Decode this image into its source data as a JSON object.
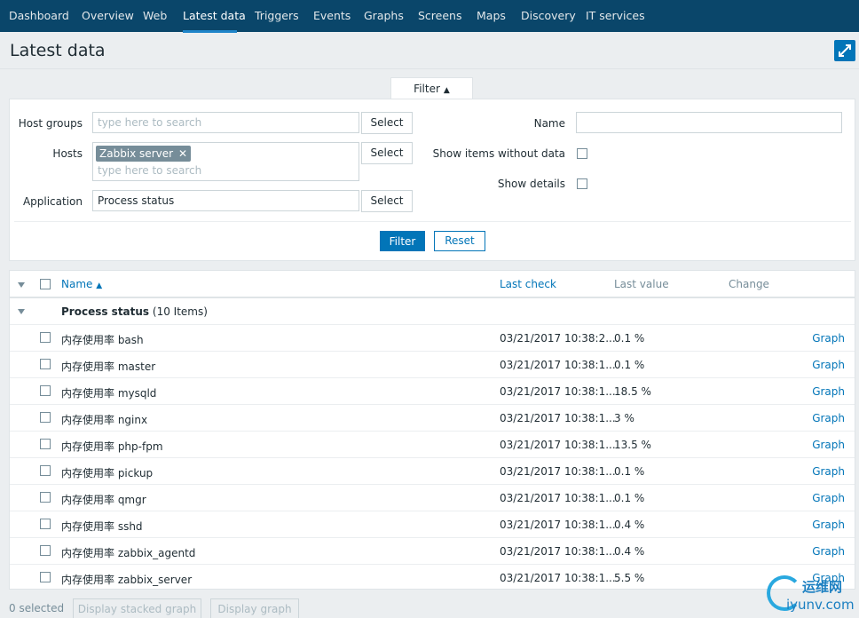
{
  "nav": {
    "items": [
      "Dashboard",
      "Overview",
      "Web",
      "Latest data",
      "Triggers",
      "Events",
      "Graphs",
      "Screens",
      "Maps",
      "Discovery",
      "IT services"
    ]
  },
  "page": {
    "title": "Latest data"
  },
  "filter": {
    "tab_label": "Filter",
    "host_groups_label": "Host groups",
    "host_groups_placeholder": "type here to search",
    "hosts_label": "Hosts",
    "hosts_chip": "Zabbix server",
    "hosts_placeholder": "type here to search",
    "application_label": "Application",
    "application_value": "Process status",
    "select_label": "Select",
    "name_label": "Name",
    "show_without_data_label": "Show items without data",
    "show_details_label": "Show details",
    "filter_button": "Filter",
    "reset_button": "Reset"
  },
  "table": {
    "headers": {
      "name": "Name",
      "last_check": "Last check",
      "last_value": "Last value",
      "change": "Change"
    },
    "group_name": "Process status",
    "group_count": "(10 Items)",
    "rows": [
      {
        "name": "内存使用率 bash",
        "last_check": "03/21/2017 10:38:2...",
        "last_value": "0.1 %",
        "action": "Graph"
      },
      {
        "name": "内存使用率 master",
        "last_check": "03/21/2017 10:38:1...",
        "last_value": "0.1 %",
        "action": "Graph"
      },
      {
        "name": "内存使用率 mysqld",
        "last_check": "03/21/2017 10:38:1...",
        "last_value": "18.5 %",
        "action": "Graph"
      },
      {
        "name": "内存使用率 nginx",
        "last_check": "03/21/2017 10:38:1...",
        "last_value": "3 %",
        "action": "Graph"
      },
      {
        "name": "内存使用率 php-fpm",
        "last_check": "03/21/2017 10:38:1...",
        "last_value": "13.5 %",
        "action": "Graph"
      },
      {
        "name": "内存使用率 pickup",
        "last_check": "03/21/2017 10:38:1...",
        "last_value": "0.1 %",
        "action": "Graph"
      },
      {
        "name": "内存使用率 qmgr",
        "last_check": "03/21/2017 10:38:1...",
        "last_value": "0.1 %",
        "action": "Graph"
      },
      {
        "name": "内存使用率 sshd",
        "last_check": "03/21/2017 10:38:1...",
        "last_value": "0.4 %",
        "action": "Graph"
      },
      {
        "name": "内存使用率 zabbix_agentd",
        "last_check": "03/21/2017 10:38:1...",
        "last_value": "0.4 %",
        "action": "Graph"
      },
      {
        "name": "内存使用率 zabbix_server",
        "last_check": "03/21/2017 10:38:1...",
        "last_value": "5.5 %",
        "action": "Graph"
      }
    ]
  },
  "footer": {
    "selected": "0 selected",
    "stacked_button": "Display stacked graph",
    "graph_button": "Display graph"
  },
  "watermark": {
    "cn": "运维网",
    "en": "iyunv.com"
  },
  "colors": {
    "nav_bg": "#0a466a",
    "accent": "#0275b8",
    "link": "#0275b8"
  }
}
